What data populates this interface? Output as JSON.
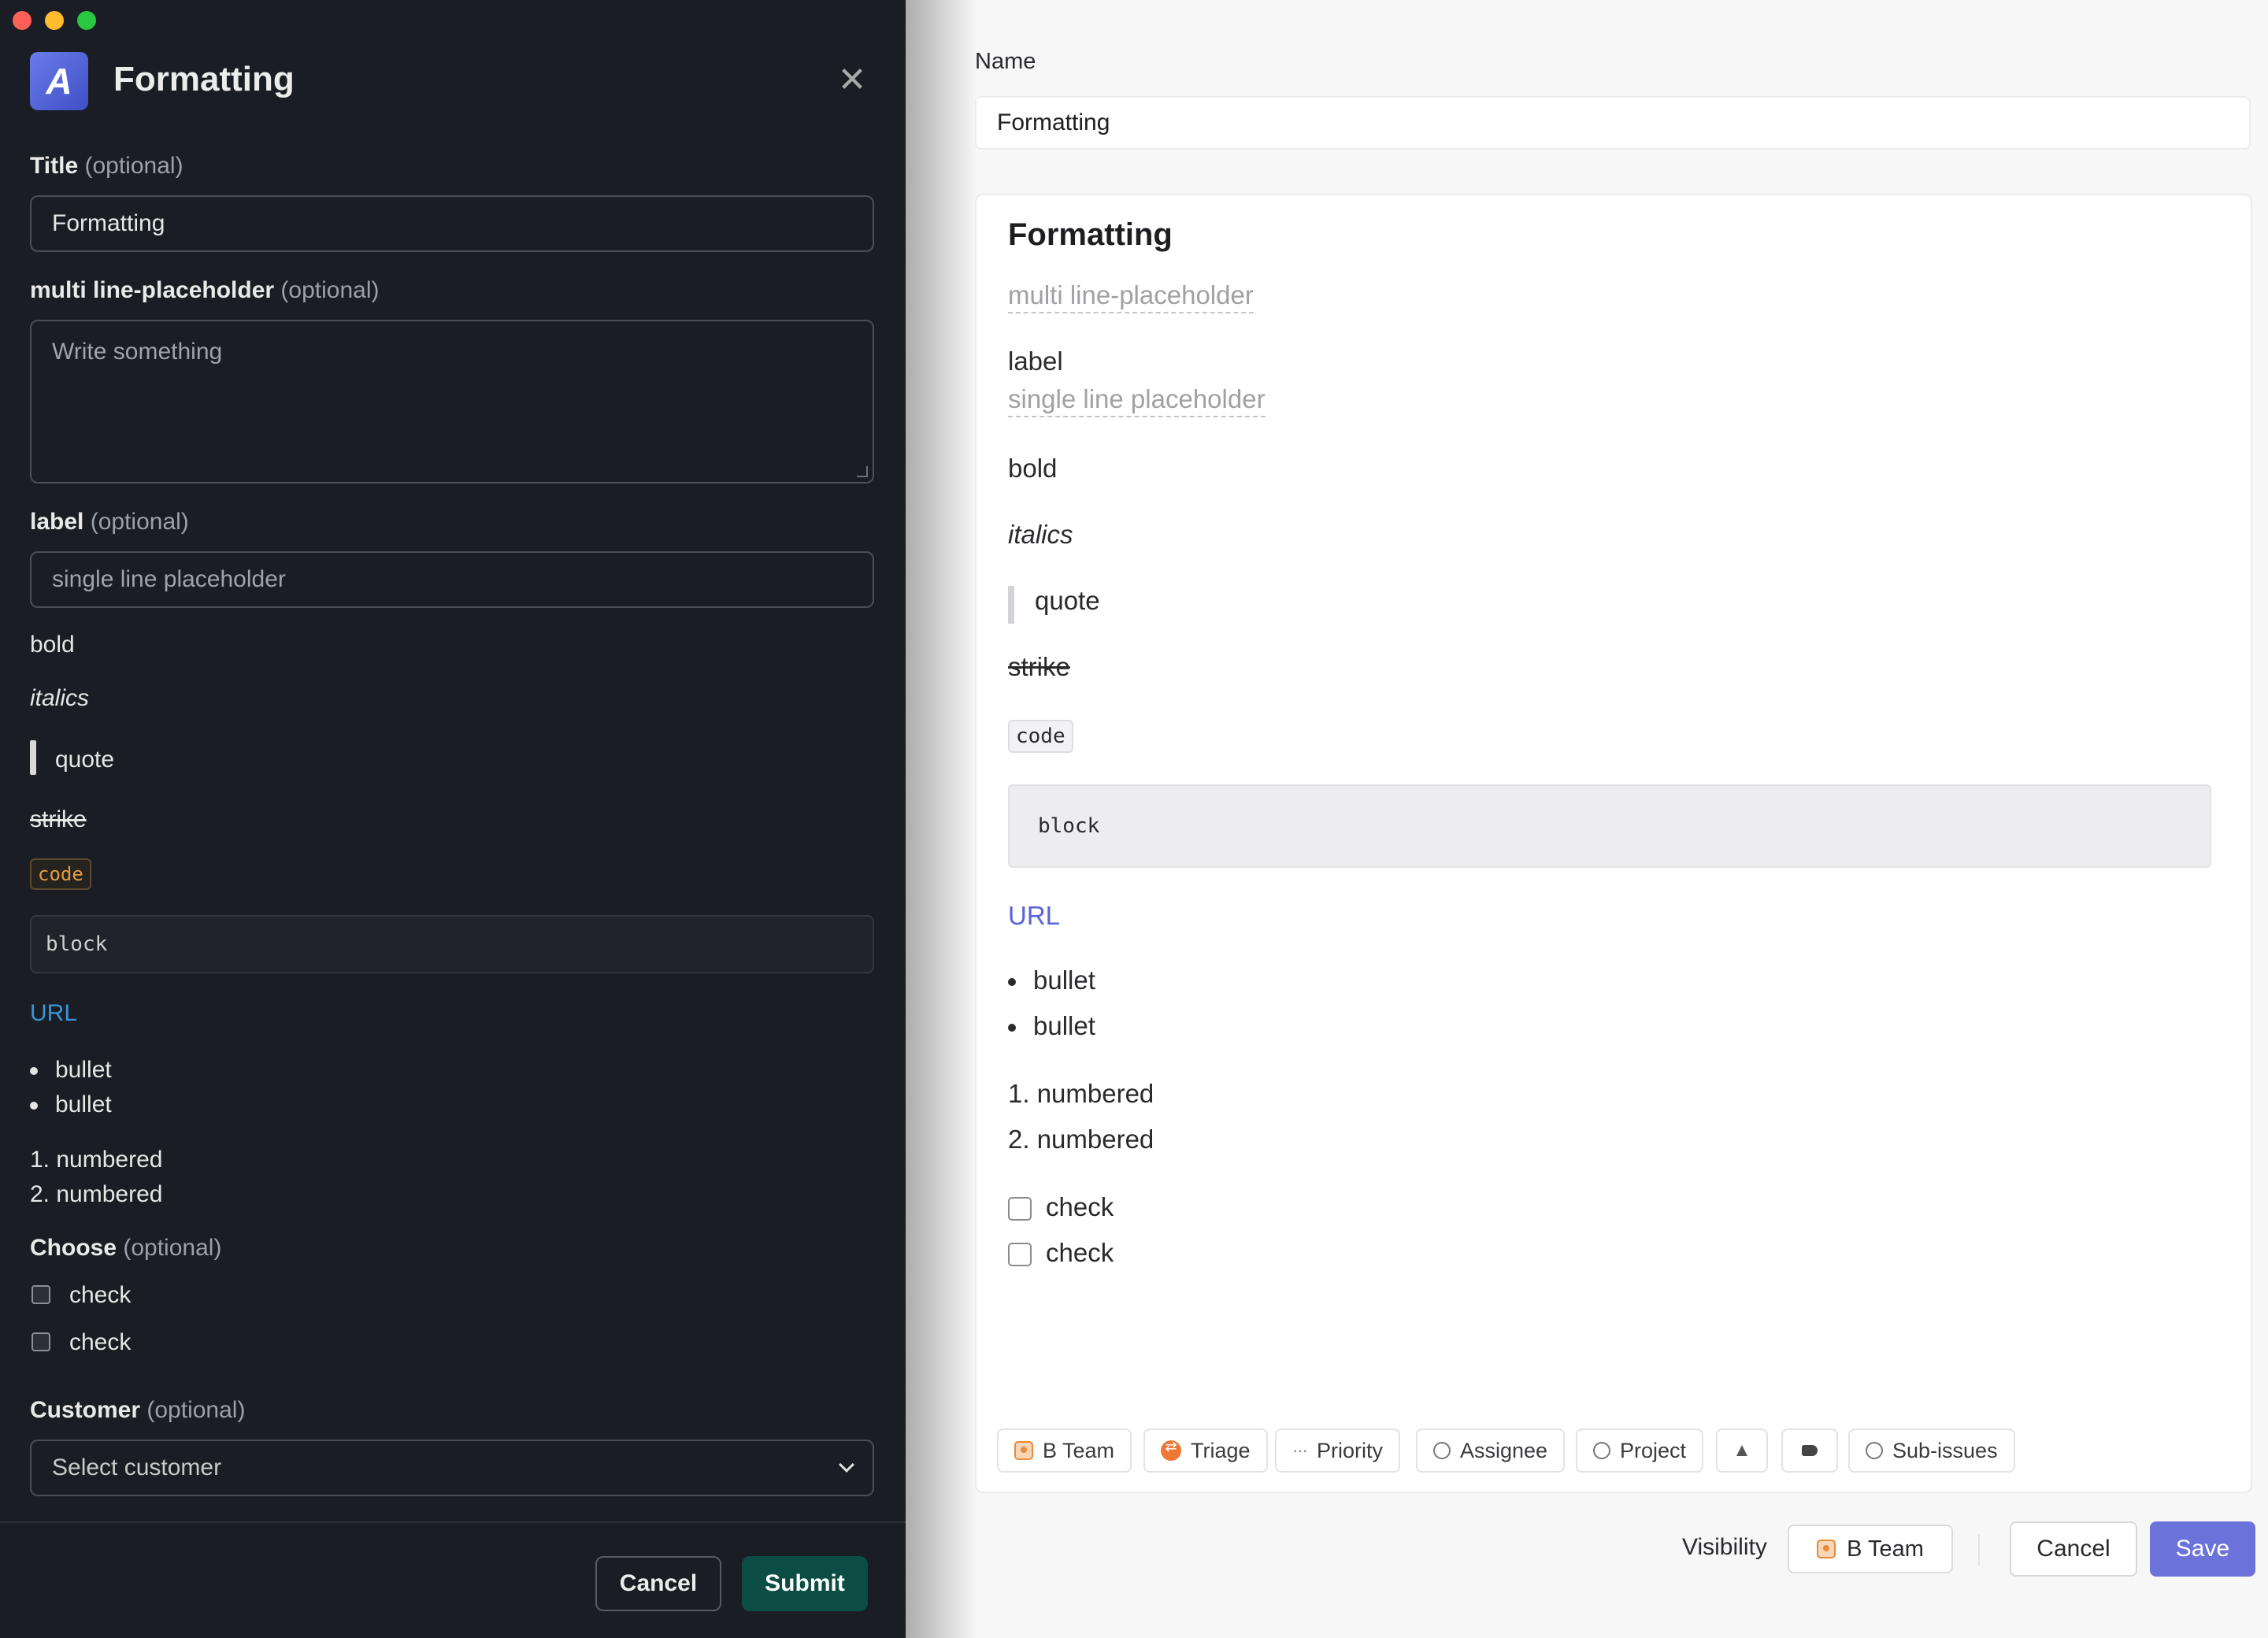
{
  "left": {
    "title": "Formatting",
    "fields": {
      "title_label": "Title",
      "title_opt": "(optional)",
      "title_value": "Formatting",
      "multi_label": "multi line-placeholder",
      "multi_opt": "(optional)",
      "multi_placeholder": "Write something",
      "label_label": "label",
      "label_opt": "(optional)",
      "label_placeholder": "single line placeholder"
    },
    "content": {
      "bold": "bold",
      "italics": "italics",
      "quote": "quote",
      "strike": "strike",
      "code": "code",
      "block": "block",
      "url": "URL",
      "bullets": [
        "bullet",
        "bullet"
      ],
      "numbered": [
        "1.  numbered",
        "2.  numbered"
      ]
    },
    "choose": {
      "label": "Choose",
      "opt": "(optional)",
      "options": [
        "check",
        "check"
      ]
    },
    "customer": {
      "label": "Customer",
      "opt": "(optional)",
      "placeholder": "Select customer"
    },
    "buttons": {
      "cancel": "Cancel",
      "submit": "Submit"
    }
  },
  "right": {
    "name_label": "Name",
    "name_value": "Formatting",
    "card": {
      "title": "Formatting",
      "multi_placeholder": "multi line-placeholder",
      "label": "label",
      "single_placeholder": "single line placeholder",
      "bold": "bold",
      "italics": "italics",
      "quote": "quote",
      "strike": "strike",
      "code": "code",
      "block": "block",
      "url": "URL",
      "bullets": [
        "bullet",
        "bullet"
      ],
      "numbered": [
        "1.  numbered",
        "2.  numbered"
      ],
      "checks": [
        "check",
        "check"
      ]
    },
    "properties": {
      "team": "B Team",
      "triage": "Triage",
      "priority": "Priority",
      "assignee": "Assignee",
      "project": "Project",
      "subissues": "Sub-issues"
    },
    "footer": {
      "visibility_label": "Visibility",
      "visibility_value": "B Team",
      "cancel": "Cancel",
      "save": "Save"
    }
  },
  "colors": {
    "dark_bg": "#1a1d23",
    "submit_green": "#0b4d45",
    "save_purple": "#6b73da",
    "link_blue_dark": "#3a95d6",
    "link_blue_light": "#5a63d6",
    "code_orange": "#e69b3f"
  }
}
